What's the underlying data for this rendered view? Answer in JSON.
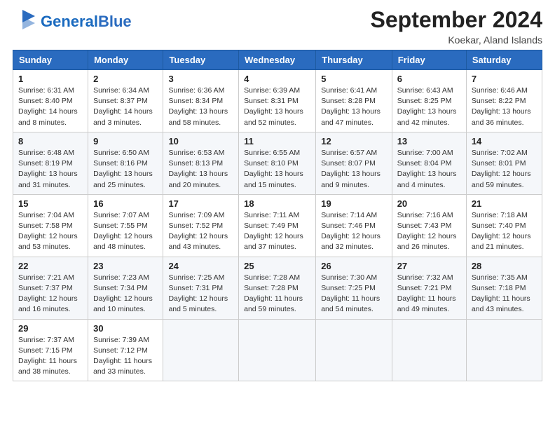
{
  "logo": {
    "text_general": "General",
    "text_blue": "Blue"
  },
  "header": {
    "month": "September 2024",
    "location": "Koekar, Aland Islands"
  },
  "days_of_week": [
    "Sunday",
    "Monday",
    "Tuesday",
    "Wednesday",
    "Thursday",
    "Friday",
    "Saturday"
  ],
  "weeks": [
    [
      {
        "day": "1",
        "sunrise": "6:31 AM",
        "sunset": "8:40 PM",
        "daylight": "14 hours and 8 minutes."
      },
      {
        "day": "2",
        "sunrise": "6:34 AM",
        "sunset": "8:37 PM",
        "daylight": "14 hours and 3 minutes."
      },
      {
        "day": "3",
        "sunrise": "6:36 AM",
        "sunset": "8:34 PM",
        "daylight": "13 hours and 58 minutes."
      },
      {
        "day": "4",
        "sunrise": "6:39 AM",
        "sunset": "8:31 PM",
        "daylight": "13 hours and 52 minutes."
      },
      {
        "day": "5",
        "sunrise": "6:41 AM",
        "sunset": "8:28 PM",
        "daylight": "13 hours and 47 minutes."
      },
      {
        "day": "6",
        "sunrise": "6:43 AM",
        "sunset": "8:25 PM",
        "daylight": "13 hours and 42 minutes."
      },
      {
        "day": "7",
        "sunrise": "6:46 AM",
        "sunset": "8:22 PM",
        "daylight": "13 hours and 36 minutes."
      }
    ],
    [
      {
        "day": "8",
        "sunrise": "6:48 AM",
        "sunset": "8:19 PM",
        "daylight": "13 hours and 31 minutes."
      },
      {
        "day": "9",
        "sunrise": "6:50 AM",
        "sunset": "8:16 PM",
        "daylight": "13 hours and 25 minutes."
      },
      {
        "day": "10",
        "sunrise": "6:53 AM",
        "sunset": "8:13 PM",
        "daylight": "13 hours and 20 minutes."
      },
      {
        "day": "11",
        "sunrise": "6:55 AM",
        "sunset": "8:10 PM",
        "daylight": "13 hours and 15 minutes."
      },
      {
        "day": "12",
        "sunrise": "6:57 AM",
        "sunset": "8:07 PM",
        "daylight": "13 hours and 9 minutes."
      },
      {
        "day": "13",
        "sunrise": "7:00 AM",
        "sunset": "8:04 PM",
        "daylight": "13 hours and 4 minutes."
      },
      {
        "day": "14",
        "sunrise": "7:02 AM",
        "sunset": "8:01 PM",
        "daylight": "12 hours and 59 minutes."
      }
    ],
    [
      {
        "day": "15",
        "sunrise": "7:04 AM",
        "sunset": "7:58 PM",
        "daylight": "12 hours and 53 minutes."
      },
      {
        "day": "16",
        "sunrise": "7:07 AM",
        "sunset": "7:55 PM",
        "daylight": "12 hours and 48 minutes."
      },
      {
        "day": "17",
        "sunrise": "7:09 AM",
        "sunset": "7:52 PM",
        "daylight": "12 hours and 43 minutes."
      },
      {
        "day": "18",
        "sunrise": "7:11 AM",
        "sunset": "7:49 PM",
        "daylight": "12 hours and 37 minutes."
      },
      {
        "day": "19",
        "sunrise": "7:14 AM",
        "sunset": "7:46 PM",
        "daylight": "12 hours and 32 minutes."
      },
      {
        "day": "20",
        "sunrise": "7:16 AM",
        "sunset": "7:43 PM",
        "daylight": "12 hours and 26 minutes."
      },
      {
        "day": "21",
        "sunrise": "7:18 AM",
        "sunset": "7:40 PM",
        "daylight": "12 hours and 21 minutes."
      }
    ],
    [
      {
        "day": "22",
        "sunrise": "7:21 AM",
        "sunset": "7:37 PM",
        "daylight": "12 hours and 16 minutes."
      },
      {
        "day": "23",
        "sunrise": "7:23 AM",
        "sunset": "7:34 PM",
        "daylight": "12 hours and 10 minutes."
      },
      {
        "day": "24",
        "sunrise": "7:25 AM",
        "sunset": "7:31 PM",
        "daylight": "12 hours and 5 minutes."
      },
      {
        "day": "25",
        "sunrise": "7:28 AM",
        "sunset": "7:28 PM",
        "daylight": "11 hours and 59 minutes."
      },
      {
        "day": "26",
        "sunrise": "7:30 AM",
        "sunset": "7:25 PM",
        "daylight": "11 hours and 54 minutes."
      },
      {
        "day": "27",
        "sunrise": "7:32 AM",
        "sunset": "7:21 PM",
        "daylight": "11 hours and 49 minutes."
      },
      {
        "day": "28",
        "sunrise": "7:35 AM",
        "sunset": "7:18 PM",
        "daylight": "11 hours and 43 minutes."
      }
    ],
    [
      {
        "day": "29",
        "sunrise": "7:37 AM",
        "sunset": "7:15 PM",
        "daylight": "11 hours and 38 minutes."
      },
      {
        "day": "30",
        "sunrise": "7:39 AM",
        "sunset": "7:12 PM",
        "daylight": "11 hours and 33 minutes."
      },
      null,
      null,
      null,
      null,
      null
    ]
  ],
  "labels": {
    "sunrise": "Sunrise: ",
    "sunset": "Sunset: ",
    "daylight": "Daylight: "
  }
}
